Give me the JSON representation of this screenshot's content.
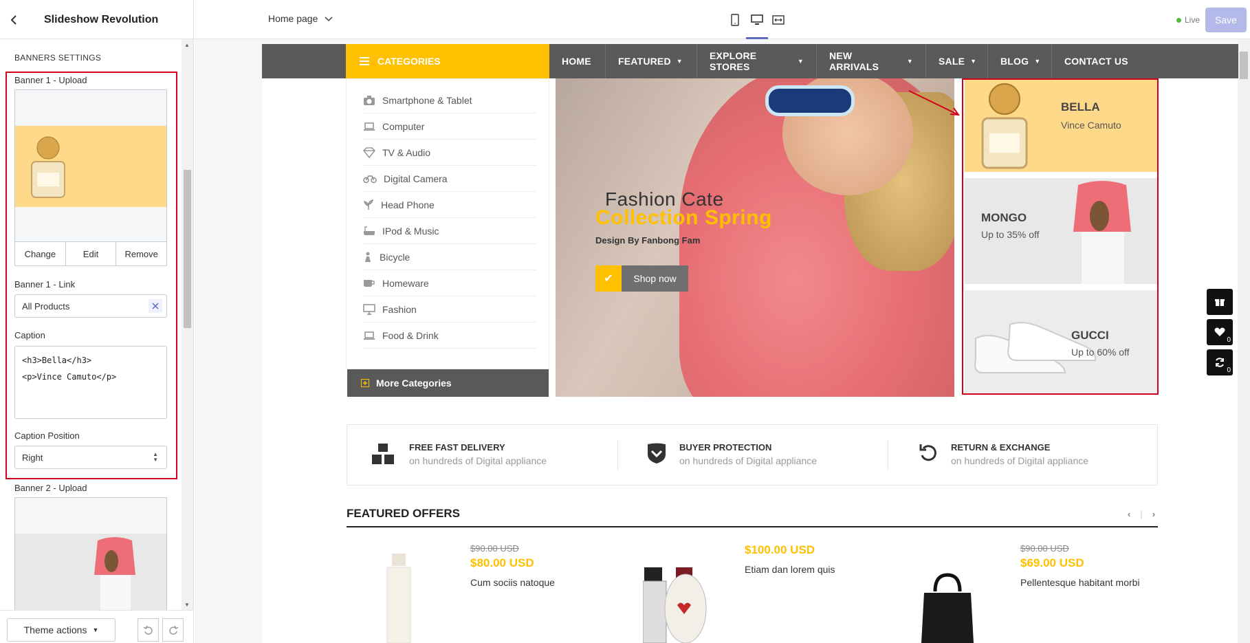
{
  "header": {
    "app_title": "Slideshow Revolution",
    "page_select": "Home page",
    "live_label": "Live",
    "save_label": "Save"
  },
  "sidebar": {
    "section_title": "BANNERS SETTINGS",
    "banner1_upload_label": "Banner 1 - Upload",
    "image_actions": [
      "Change",
      "Edit",
      "Remove"
    ],
    "banner1_link_label": "Banner 1 - Link",
    "banner1_link_value": "All Products",
    "caption_label": "Caption",
    "caption_value": "<h3>Bella</h3>\n<p>Vince Camuto</p>",
    "caption_position_label": "Caption Position",
    "caption_position_value": "Right",
    "banner2_upload_label": "Banner 2 - Upload",
    "theme_actions_label": "Theme actions"
  },
  "shop": {
    "categories_label": "CATEGORIES",
    "nav": [
      {
        "label": "HOME",
        "caret": false
      },
      {
        "label": "FEATURED",
        "caret": true
      },
      {
        "label": "EXPLORE STORES",
        "caret": true
      },
      {
        "label": "NEW ARRIVALS",
        "caret": true
      },
      {
        "label": "SALE",
        "caret": true
      },
      {
        "label": "BLOG",
        "caret": true
      },
      {
        "label": "CONTACT US",
        "caret": false
      }
    ],
    "categories": [
      {
        "label": "Smartphone & Tablet",
        "icon": "camera-icon"
      },
      {
        "label": "Computer",
        "icon": "laptop-icon"
      },
      {
        "label": "TV & Audio",
        "icon": "diamond-icon"
      },
      {
        "label": "Digital Camera",
        "icon": "bicycle-icon"
      },
      {
        "label": "Head Phone",
        "icon": "plant-icon"
      },
      {
        "label": "IPod & Music",
        "icon": "bathtub-icon"
      },
      {
        "label": "Bicycle",
        "icon": "person-icon"
      },
      {
        "label": "Homeware",
        "icon": "cup-icon"
      },
      {
        "label": "Fashion",
        "icon": "monitor-icon"
      },
      {
        "label": "Food & Drink",
        "icon": "laptop-icon"
      }
    ],
    "more_categories": "More Categories",
    "hero": {
      "line1": "Fashion Cate",
      "line2": "Collection Spring",
      "line3": "Design By Fanbong Fam",
      "button": "Shop now"
    },
    "banners": [
      {
        "title": "BELLA",
        "subtitle": "Vince Camuto",
        "bg": "#ffd98a"
      },
      {
        "title": "MONGO",
        "subtitle": "Up to 35% off",
        "bg": "#e8e8e8"
      },
      {
        "title": "GUCCI",
        "subtitle": "Up to 60% off",
        "bg": "#ececec"
      }
    ],
    "side_counts": {
      "wishlist": "0",
      "compare": "0"
    },
    "features": [
      {
        "title": "FREE FAST DELIVERY",
        "subtitle": "on hundreds of Digital appliance",
        "icon": "boxes-icon"
      },
      {
        "title": "BUYER PROTECTION",
        "subtitle": "on hundreds of Digital appliance",
        "icon": "shield-icon"
      },
      {
        "title": "RETURN & EXCHANGE",
        "subtitle": "on hundreds of Digital appliance",
        "icon": "return-icon"
      }
    ],
    "featured_title": "FEATURED OFFERS",
    "products": [
      {
        "old_price": "$90.00 USD",
        "price": "$80.00 USD",
        "name": "Cum sociis natoque"
      },
      {
        "old_price": "",
        "price": "$100.00 USD",
        "name": "Etiam dan lorem quis"
      },
      {
        "old_price": "$90.00 USD",
        "price": "$69.00 USD",
        "name": "Pellentesque habitant morbi"
      }
    ]
  },
  "colors": {
    "accent_yellow": "#ffc000",
    "nav_gray": "#595959",
    "highlight_red": "#d0021b",
    "save_disabled": "#b3b9e8"
  }
}
